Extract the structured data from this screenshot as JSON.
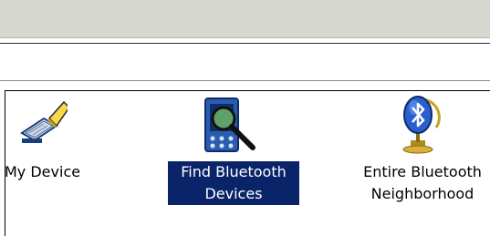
{
  "items": [
    {
      "label": "My Device",
      "icon": "device-icon"
    },
    {
      "label_line1": "Find Bluetooth",
      "label_line2": "Devices",
      "icon": "find-bluetooth-icon",
      "selected": true
    },
    {
      "label_line1": "Entire Bluetooth",
      "label_line2": "Neighborhood",
      "icon": "bluetooth-globe-icon"
    }
  ],
  "colors": {
    "selection": "#0a246a",
    "toolbar": "#d6d7cf"
  }
}
